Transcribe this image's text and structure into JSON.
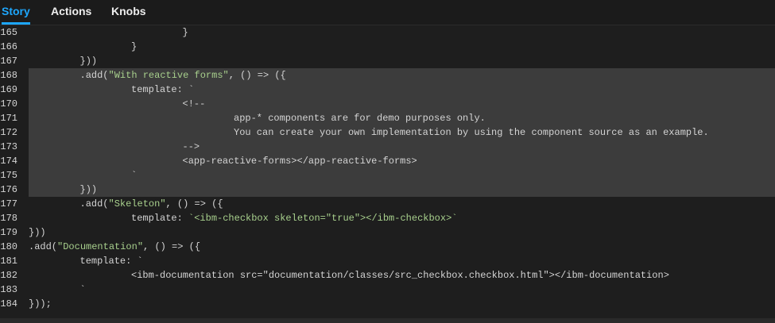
{
  "tabs": [
    {
      "label": "Story",
      "active": true
    },
    {
      "label": "Actions",
      "active": false
    },
    {
      "label": "Knobs",
      "active": false
    }
  ],
  "code_lines": [
    {
      "n": "165",
      "indent": 3,
      "code": "}"
    },
    {
      "n": "166",
      "indent": 2,
      "code": "}"
    },
    {
      "n": "167",
      "indent": 1,
      "code": "}))"
    },
    {
      "n": "168",
      "indent": 1,
      "code": ".add(\"With reactive forms\", () => ({",
      "str": "\"With reactive forms\""
    },
    {
      "n": "169",
      "indent": 2,
      "code": "template: `"
    },
    {
      "n": "170",
      "indent": 3,
      "code": "<!--"
    },
    {
      "n": "171",
      "indent": 4,
      "code": "app-* components are for demo purposes only."
    },
    {
      "n": "172",
      "indent": 4,
      "code": "You can create your own implementation by using the component source as an example."
    },
    {
      "n": "173",
      "indent": 3,
      "code": "-->"
    },
    {
      "n": "174",
      "indent": 3,
      "code": "<app-reactive-forms></app-reactive-forms>"
    },
    {
      "n": "175",
      "indent": 2,
      "code": "`"
    },
    {
      "n": "176",
      "indent": 1,
      "code": "}))"
    },
    {
      "n": "177",
      "indent": 1,
      "code": ".add(\"Skeleton\", () => ({",
      "str": "\"Skeleton\""
    },
    {
      "n": "178",
      "indent": 2,
      "code": "template: `<ibm-checkbox skeleton=\"true\"></ibm-checkbox>`",
      "str": "`<ibm-checkbox skeleton=\"true\"></ibm-checkbox>`"
    },
    {
      "n": "179",
      "indent": 0,
      "code": "}))"
    },
    {
      "n": "180",
      "indent": 0,
      "code": ".add(\"Documentation\", () => ({",
      "str": "\"Documentation\""
    },
    {
      "n": "181",
      "indent": 1,
      "code": "template: `"
    },
    {
      "n": "182",
      "indent": 2,
      "code": "<ibm-documentation src=\"documentation/classes/src_checkbox.checkbox.html\"></ibm-documentation>"
    },
    {
      "n": "183",
      "indent": 1,
      "code": "`"
    },
    {
      "n": "184",
      "indent": 0,
      "code": "}));"
    }
  ],
  "colors": {
    "accent": "#1ea7fd",
    "string": "#a8d08d",
    "highlight": "#3c3c3c",
    "text": "#d4d4d4"
  }
}
